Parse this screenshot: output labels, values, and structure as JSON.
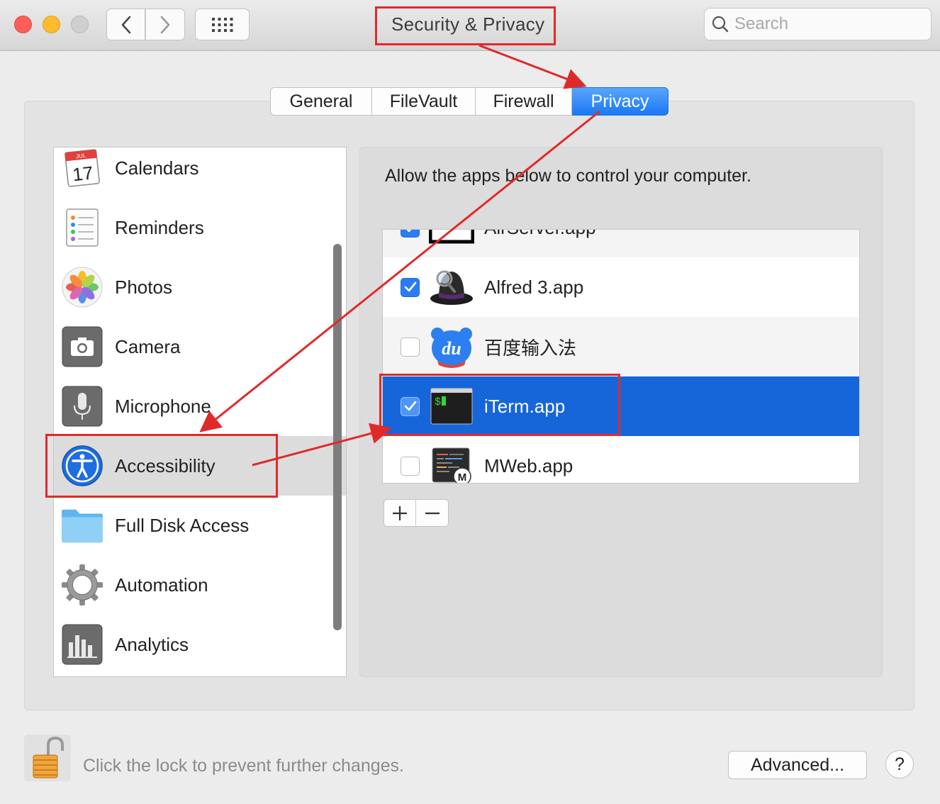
{
  "window": {
    "title": "Security & Privacy",
    "search_placeholder": "Search"
  },
  "tabs": [
    {
      "label": "General",
      "active": false
    },
    {
      "label": "FileVault",
      "active": false
    },
    {
      "label": "Firewall",
      "active": false
    },
    {
      "label": "Privacy",
      "active": true
    }
  ],
  "sidebar": {
    "items": [
      {
        "label": "Calendars",
        "icon": "calendar-icon",
        "icon_month": "JUL",
        "icon_day": "17"
      },
      {
        "label": "Reminders",
        "icon": "reminders-icon"
      },
      {
        "label": "Photos",
        "icon": "photos-icon"
      },
      {
        "label": "Camera",
        "icon": "camera-icon"
      },
      {
        "label": "Microphone",
        "icon": "microphone-icon"
      },
      {
        "label": "Accessibility",
        "icon": "accessibility-icon",
        "selected": true
      },
      {
        "label": "Full Disk Access",
        "icon": "folder-icon"
      },
      {
        "label": "Automation",
        "icon": "gear-icon"
      },
      {
        "label": "Analytics",
        "icon": "analytics-icon"
      }
    ]
  },
  "main": {
    "description": "Allow the apps below to control your computer.",
    "apps": [
      {
        "name": "AirServer.app",
        "checked": true,
        "icon": "airserver-icon"
      },
      {
        "name": "Alfred 3.app",
        "checked": true,
        "icon": "alfred-icon"
      },
      {
        "name": "百度输入法",
        "checked": false,
        "icon": "baidu-input-icon",
        "icon_text": "du"
      },
      {
        "name": "iTerm.app",
        "checked": true,
        "icon": "iterm-icon",
        "selected": true,
        "icon_text": "$"
      },
      {
        "name": "MWeb.app",
        "checked": false,
        "icon": "mweb-icon",
        "icon_text": "M"
      }
    ],
    "add_label": "+",
    "remove_label": "−"
  },
  "footer": {
    "lock_text": "Click the lock to prevent further changes.",
    "advanced_label": "Advanced...",
    "help_label": "?"
  },
  "colors": {
    "accent": "#1b78f2",
    "selection": "#1666d9",
    "annotation": "#e02a2a"
  }
}
